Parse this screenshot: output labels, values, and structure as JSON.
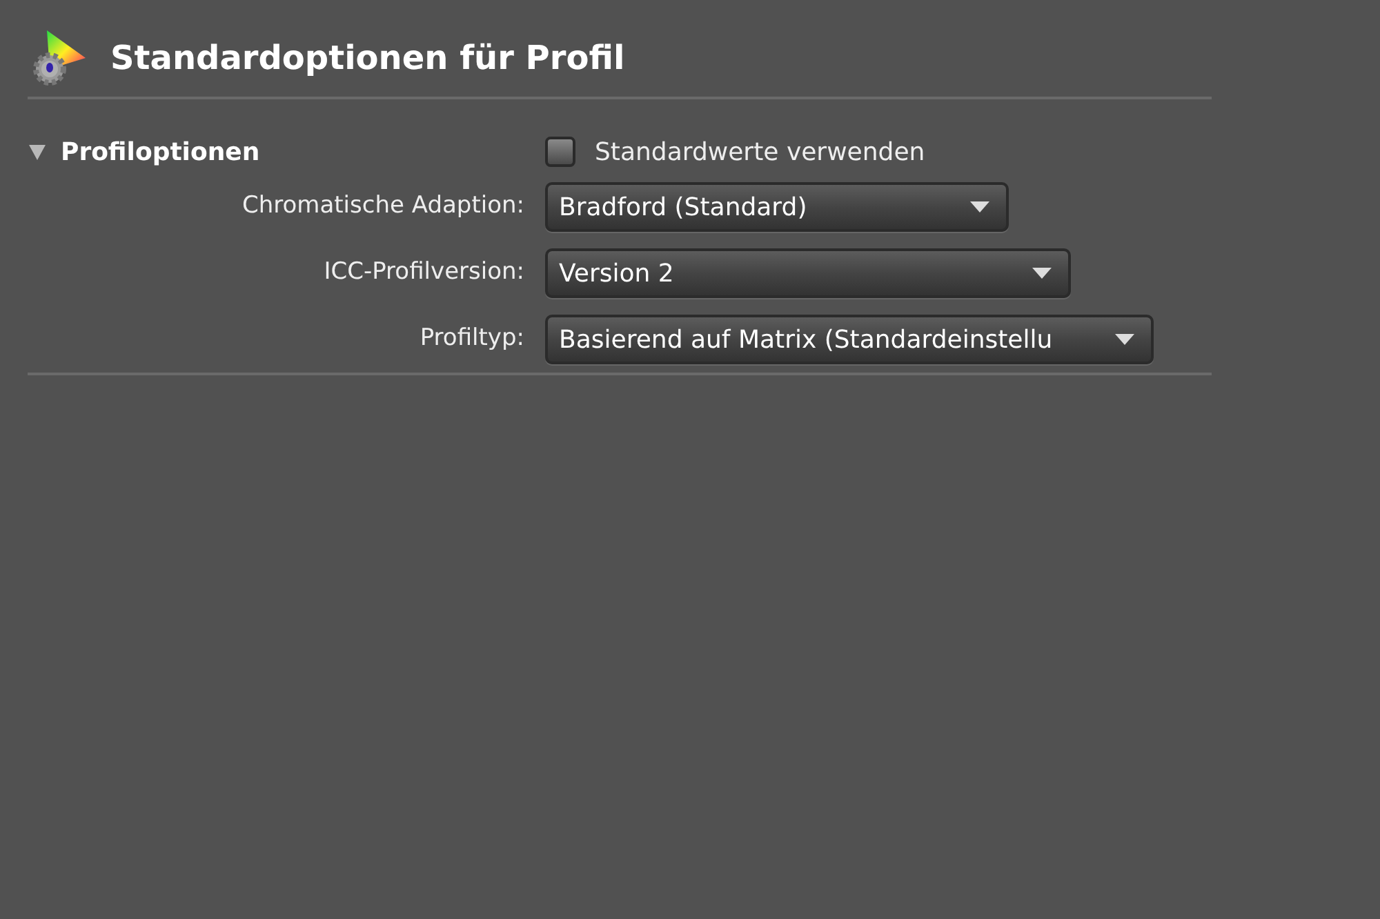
{
  "title": "Standardoptionen für Profil",
  "section": {
    "label": "Profiloptionen",
    "expanded": true
  },
  "defaults_checkbox": {
    "label": "Standardwerte verwenden",
    "checked": false
  },
  "fields": [
    {
      "label": "Chromatische Adaption:",
      "value": "Bradford (Standard)"
    },
    {
      "label": "ICC-Profilversion:",
      "value": "Version 2"
    },
    {
      "label": "Profiltyp:",
      "value": "Basierend auf Matrix (Standardeinstellu"
    }
  ]
}
